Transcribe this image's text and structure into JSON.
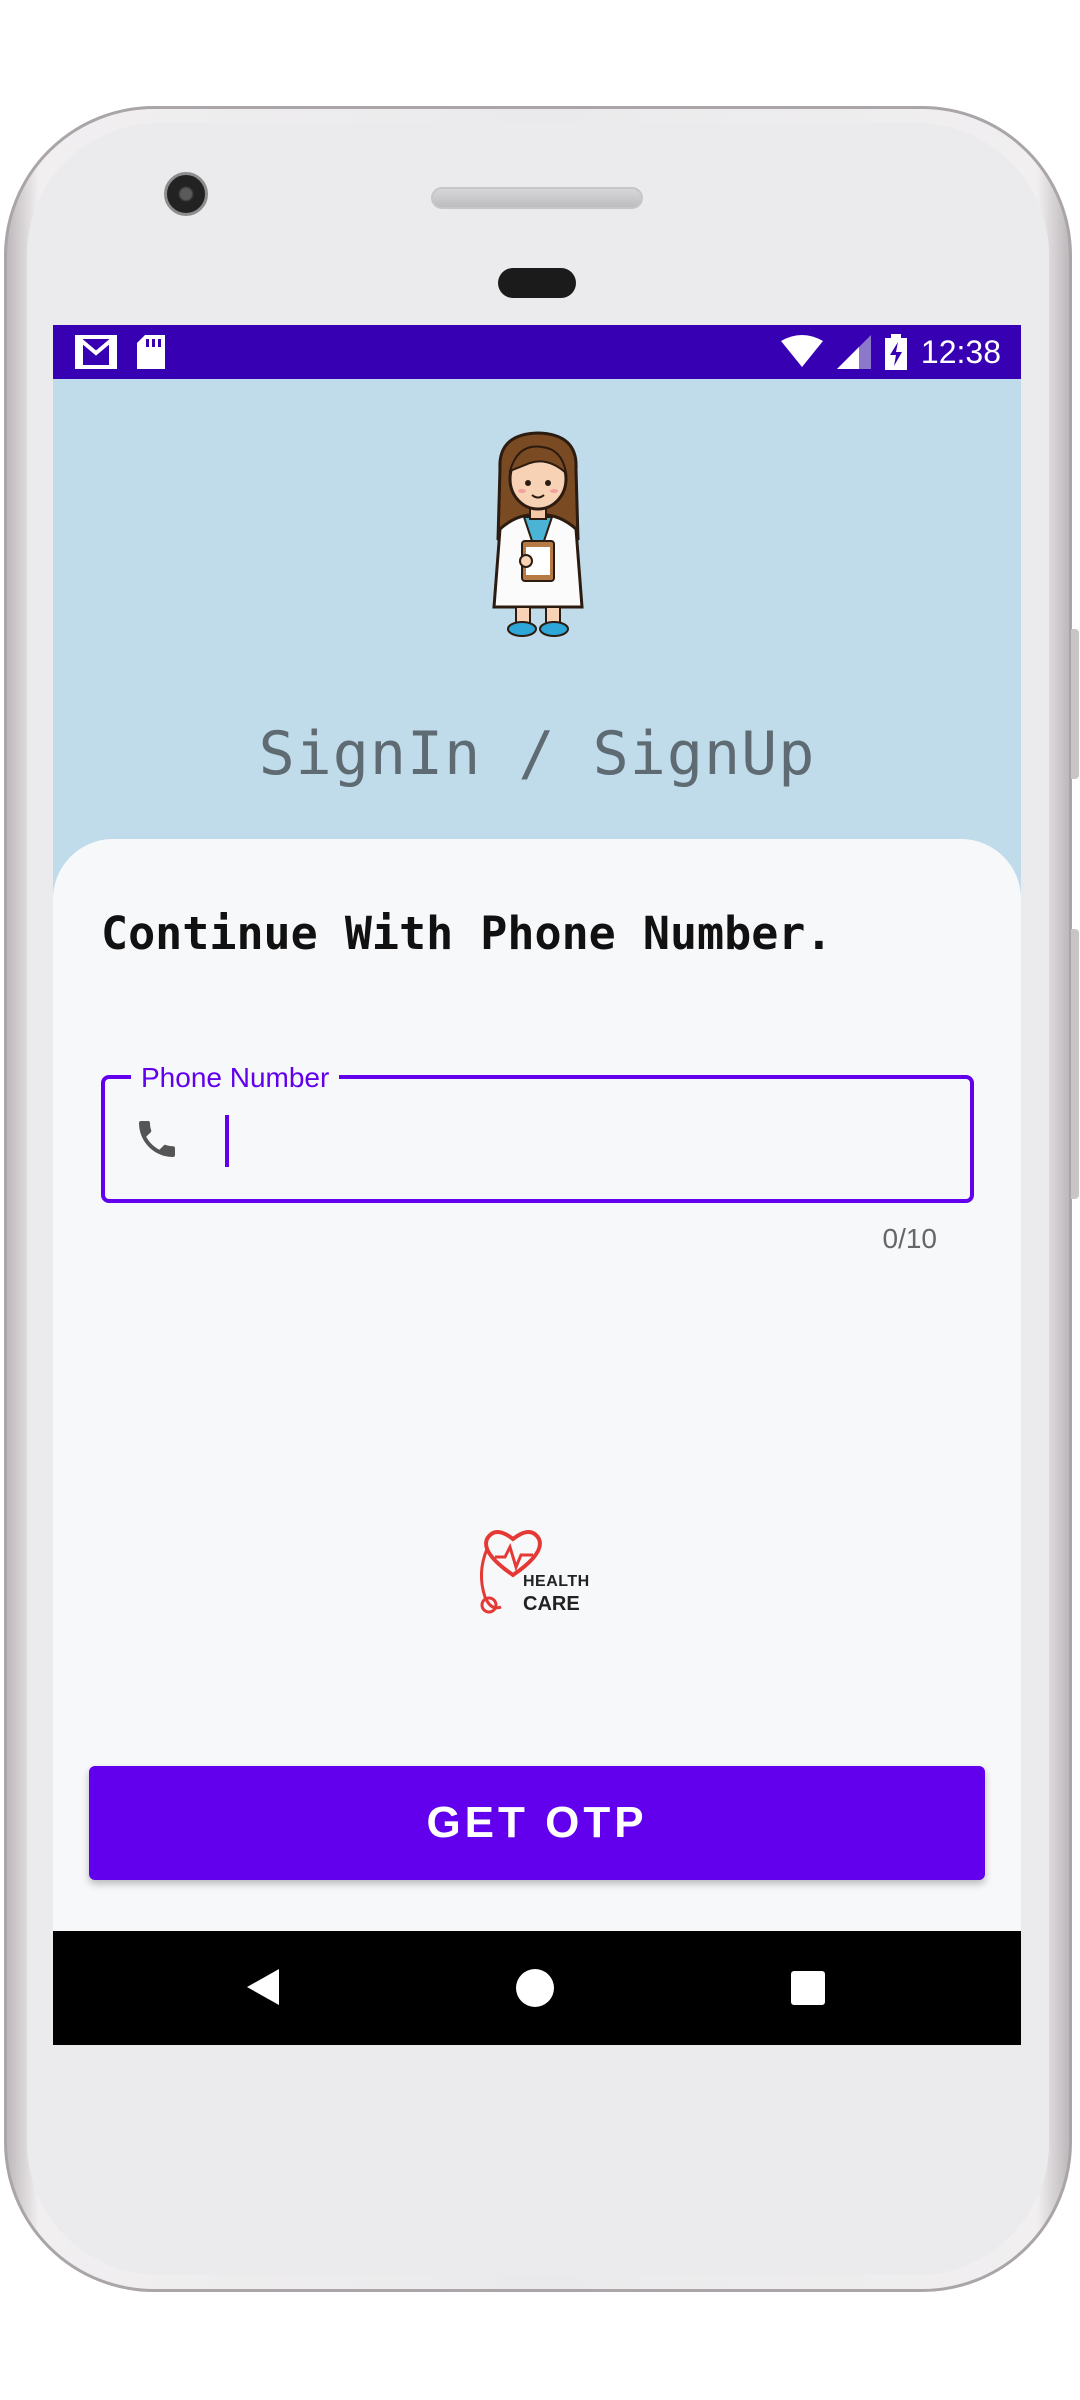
{
  "status_bar": {
    "time": "12:38",
    "left_icons": [
      "gmail-icon",
      "sd-card-icon"
    ],
    "right_icons": [
      "wifi-icon",
      "signal-icon",
      "battery-charging-icon"
    ]
  },
  "header": {
    "illustration": "doctor-illustration",
    "title": "SignIn / SignUp"
  },
  "card": {
    "subtitle": "Continue With Phone Number.",
    "phone_field": {
      "label": "Phone Number",
      "value": "",
      "icon": "phone-icon",
      "counter": "0/10"
    },
    "logo": {
      "line1": "HEALTH",
      "line2": "CARE"
    },
    "button_label": "GET OTP"
  },
  "nav_bar": {
    "buttons": [
      "back-icon",
      "home-icon",
      "recents-icon"
    ]
  },
  "colors": {
    "primary": "#6200ee",
    "status_bar": "#3700b3",
    "header_bg": "#c0dceb",
    "card_bg": "#f7f8fa"
  }
}
